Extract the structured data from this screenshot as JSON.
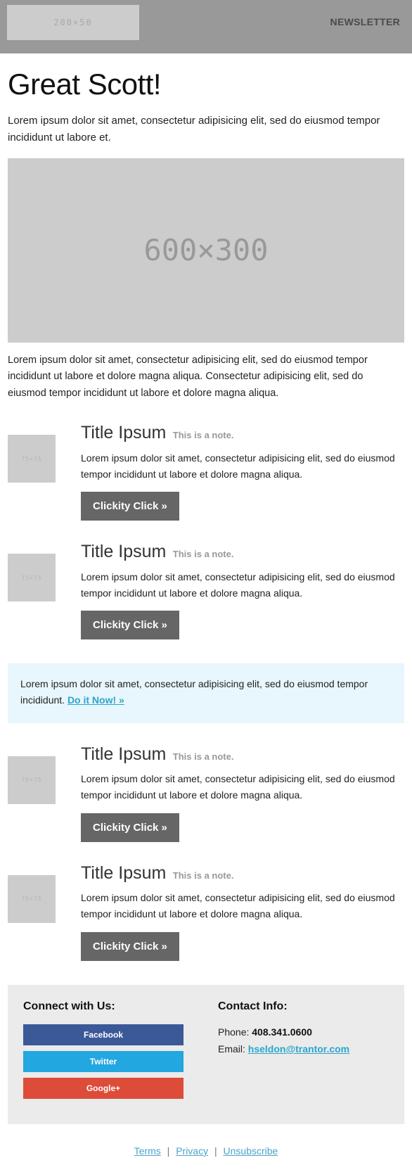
{
  "header": {
    "logo_placeholder": "200×50",
    "title": "NEWSLETTER"
  },
  "hero": {
    "title": "Great Scott!",
    "lede": "Lorem ipsum dolor sit amet, consectetur adipisicing elit, sed do eiusmod tempor incididunt ut labore et.",
    "image_placeholder": "600×300",
    "body": "Lorem ipsum dolor sit amet, consectetur adipisicing elit, sed do eiusmod tempor incididunt ut labore et dolore magna aliqua. Consectetur adipisicing elit, sed do eiusmod tempor incididunt ut labore et dolore magna aliqua."
  },
  "articles": [
    {
      "thumb": "75×75",
      "title": "Title Ipsum",
      "note": "This is a note.",
      "text": "Lorem ipsum dolor sit amet, consectetur adipisicing elit, sed do eiusmod tempor incididunt ut labore et dolore magna aliqua.",
      "button": "Clickity Click »"
    },
    {
      "thumb": "75×75",
      "title": "Title Ipsum",
      "note": "This is a note.",
      "text": "Lorem ipsum dolor sit amet, consectetur adipisicing elit, sed do eiusmod tempor incididunt ut labore et dolore magna aliqua.",
      "button": "Clickity Click »"
    },
    {
      "thumb": "75×75",
      "title": "Title Ipsum",
      "note": "This is a note.",
      "text": "Lorem ipsum dolor sit amet, consectetur adipisicing elit, sed do eiusmod tempor incididunt ut labore et dolore magna aliqua.",
      "button": "Clickity Click »"
    },
    {
      "thumb": "75×75",
      "title": "Title Ipsum",
      "note": "This is a note.",
      "text": "Lorem ipsum dolor sit amet, consectetur adipisicing elit, sed do eiusmod tempor incididunt ut labore et dolore magna aliqua.",
      "button": "Clickity Click »"
    }
  ],
  "callout": {
    "text": "Lorem ipsum dolor sit amet, consectetur adipisicing elit, sed do eiusmod tempor incididunt.",
    "link": "Do it Now! »"
  },
  "footer": {
    "social_heading": "Connect with Us:",
    "social_buttons": [
      {
        "label": "Facebook",
        "color": "#3b5998"
      },
      {
        "label": "Twitter",
        "color": "#22a7e0"
      },
      {
        "label": "Google+",
        "color": "#dd4b39"
      }
    ],
    "contact_heading": "Contact Info:",
    "phone_label": "Phone:",
    "phone_value": "408.341.0600",
    "email_label": "Email:",
    "email_value": "hseldon@trantor.com"
  },
  "legal": {
    "terms": "Terms",
    "privacy": "Privacy",
    "unsubscribe": "Unsubscribe",
    "separator": "|"
  },
  "colors": {
    "header_bg": "#999999",
    "placeholder_bg": "#cccccc",
    "button_bg": "#666666",
    "callout_bg": "#e8f6fd",
    "link": "#2ba6cb",
    "footer_bg": "#ebebeb"
  }
}
